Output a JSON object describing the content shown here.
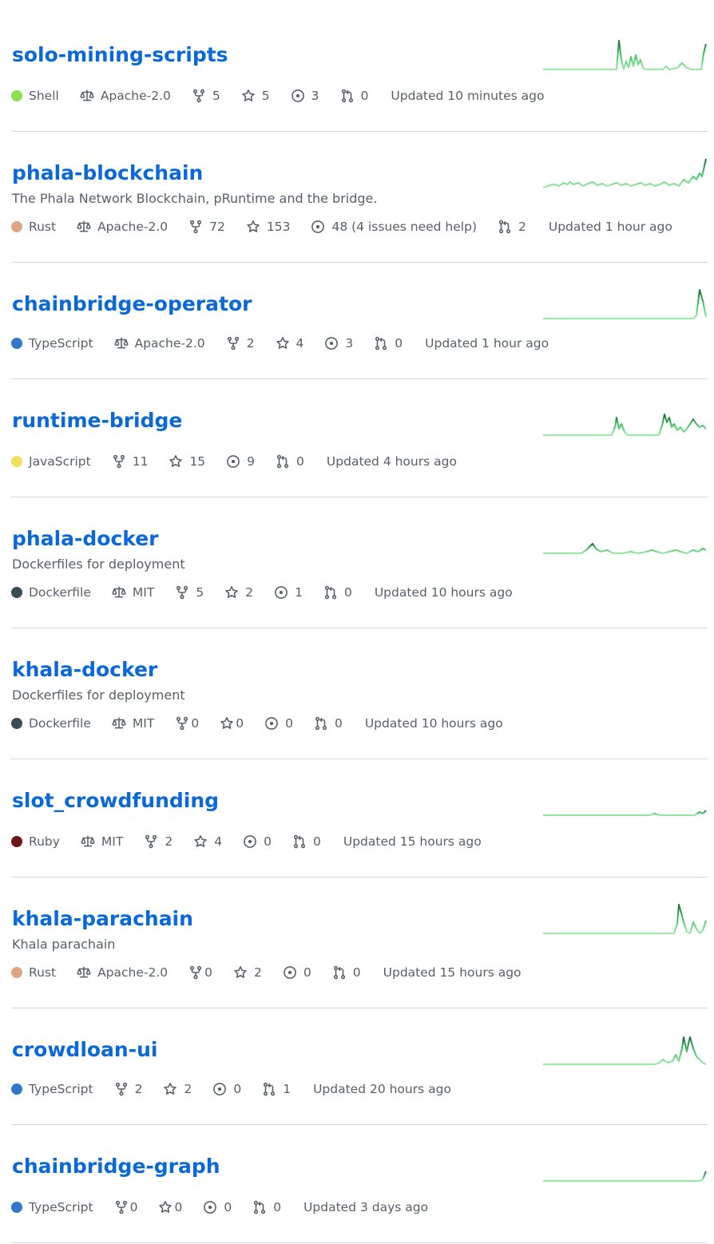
{
  "repos": [
    {
      "name": "solo-mining-scripts",
      "description": "",
      "language": "Shell",
      "language_color": "#89e051",
      "license": "Apache-2.0",
      "forks": "5",
      "stars": "5",
      "issues": "3",
      "pulls": "0",
      "updated": "Updated 10 minutes ago"
    },
    {
      "name": "phala-blockchain",
      "description": "The Phala Network Blockchain, pRuntime and the bridge.",
      "language": "Rust",
      "language_color": "#dea584",
      "license": "Apache-2.0",
      "forks": "72",
      "stars": "153",
      "issues": "48 (4 issues need help)",
      "pulls": "2",
      "updated": "Updated 1 hour ago"
    },
    {
      "name": "chainbridge-operator",
      "description": "",
      "language": "TypeScript",
      "language_color": "#3178c6",
      "license": "Apache-2.0",
      "forks": "2",
      "stars": "4",
      "issues": "3",
      "pulls": "0",
      "updated": "Updated 1 hour ago"
    },
    {
      "name": "runtime-bridge",
      "description": "",
      "language": "JavaScript",
      "language_color": "#f1e05a",
      "license": "",
      "forks": "11",
      "stars": "15",
      "issues": "9",
      "pulls": "0",
      "updated": "Updated 4 hours ago"
    },
    {
      "name": "phala-docker",
      "description": "Dockerfiles for deployment",
      "language": "Dockerfile",
      "language_color": "#384d54",
      "license": "MIT",
      "forks": "5",
      "stars": "2",
      "issues": "1",
      "pulls": "0",
      "updated": "Updated 10 hours ago"
    },
    {
      "name": "khala-docker",
      "description": "Dockerfiles for deployment",
      "language": "Dockerfile",
      "language_color": "#384d54",
      "license": "MIT",
      "forks": "0",
      "stars": "0",
      "issues": "0",
      "pulls": "0",
      "updated": "Updated 10 hours ago"
    },
    {
      "name": "slot_crowdfunding",
      "description": "",
      "language": "Ruby",
      "language_color": "#701516",
      "license": "MIT",
      "forks": "2",
      "stars": "4",
      "issues": "0",
      "pulls": "0",
      "updated": "Updated 15 hours ago"
    },
    {
      "name": "khala-parachain",
      "description": "Khala parachain",
      "language": "Rust",
      "language_color": "#dea584",
      "license": "Apache-2.0",
      "forks": "0",
      "stars": "2",
      "issues": "0",
      "pulls": "0",
      "updated": "Updated 15 hours ago"
    },
    {
      "name": "crowdloan-ui",
      "description": "",
      "language": "TypeScript",
      "language_color": "#3178c6",
      "license": "",
      "forks": "2",
      "stars": "2",
      "issues": "0",
      "pulls": "1",
      "updated": "Updated 20 hours ago"
    },
    {
      "name": "chainbridge-graph",
      "description": "",
      "language": "TypeScript",
      "language_color": "#3178c6",
      "license": "",
      "forks": "0",
      "stars": "0",
      "issues": "0",
      "pulls": "0",
      "updated": "Updated 3 days ago"
    }
  ],
  "sparklines": [
    [
      0,
      0,
      0,
      0,
      0,
      0,
      0,
      0,
      0,
      0,
      0,
      0,
      0,
      0,
      0,
      0,
      0,
      0,
      0,
      0,
      0,
      0,
      0,
      0,
      0,
      0,
      0,
      0,
      0,
      0,
      0,
      0,
      0,
      0,
      0,
      0,
      0,
      0,
      0,
      0,
      0,
      0,
      0,
      0,
      0,
      0,
      0,
      0,
      0,
      0,
      0,
      0,
      0,
      0,
      0,
      0,
      0,
      0,
      0,
      0,
      0,
      0,
      0,
      0,
      0,
      0,
      0,
      0,
      0,
      0,
      0,
      0,
      0,
      0,
      0,
      0,
      0,
      0,
      0,
      0,
      0,
      0,
      0,
      0,
      0,
      0,
      0,
      0,
      0,
      0,
      0,
      0,
      0,
      0,
      0,
      0,
      0,
      0,
      0,
      0,
      0,
      0,
      0,
      0,
      0,
      0,
      0,
      0,
      0,
      0,
      0,
      0,
      0,
      0,
      0,
      0,
      0,
      0,
      0,
      0,
      0,
      0,
      0,
      0,
      0,
      0,
      0,
      0,
      0,
      0,
      0,
      0,
      0,
      0,
      0,
      0,
      0,
      0,
      0,
      0,
      0,
      0,
      0,
      0,
      0,
      0,
      0,
      0,
      0,
      0,
      0,
      0,
      0,
      0,
      0,
      0,
      0,
      0,
      0,
      0,
      0,
      0,
      0,
      0,
      0,
      0,
      0,
      0,
      0,
      0,
      0,
      0,
      0,
      0,
      0,
      0,
      0,
      0,
      0,
      0,
      0,
      0,
      0,
      0,
      0,
      0,
      0,
      0,
      0,
      0,
      0,
      0,
      0,
      0,
      0,
      0,
      0,
      0,
      0,
      0,
      0,
      0,
      0,
      0,
      0,
      0,
      0,
      0,
      0,
      0,
      0,
      0,
      0,
      0,
      0,
      0,
      0,
      0,
      0,
      0
    ],
    [],
    [],
    [],
    [],
    [],
    [],
    [],
    [],
    []
  ]
}
